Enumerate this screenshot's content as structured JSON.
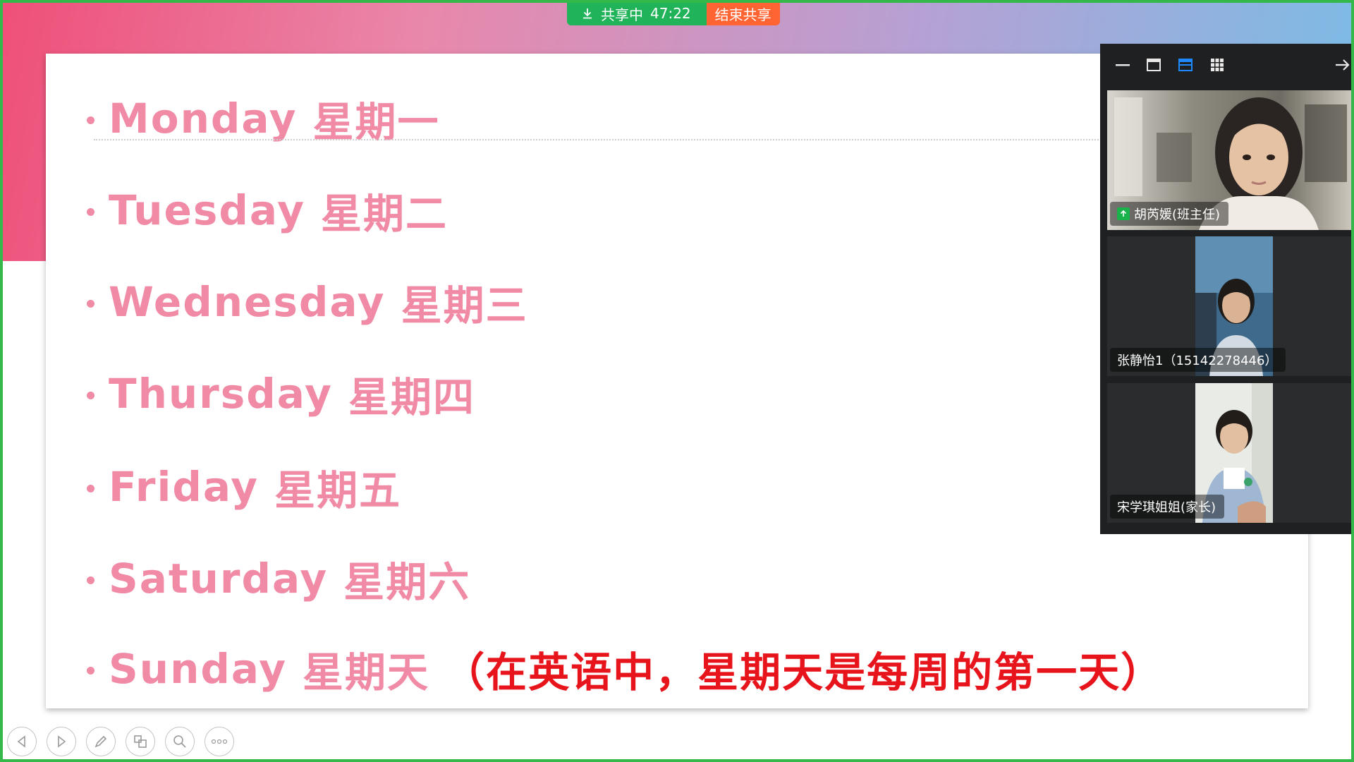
{
  "share_bar": {
    "status_label": "共享中",
    "timer": "47:22",
    "end_button": "结束共享"
  },
  "slide": {
    "days": [
      {
        "english": "Monday",
        "chinese": "星期一"
      },
      {
        "english": "Tuesday",
        "chinese": "星期二"
      },
      {
        "english": "Wednesday",
        "chinese": "星期三"
      },
      {
        "english": "Thursday",
        "chinese": "星期四"
      },
      {
        "english": "Friday",
        "chinese": "星期五"
      },
      {
        "english": "Saturday",
        "chinese": "星期六"
      },
      {
        "english": "Sunday",
        "chinese": "星期天"
      }
    ],
    "sunday_note": "（在英语中，星期天是每周的第一天）",
    "colors": {
      "day_text": "#f08aa5",
      "note_text": "#e8141c"
    }
  },
  "video_panel": {
    "toolbar_icons": [
      "minimize-icon",
      "window-icon",
      "speaker-view-icon",
      "grid-view-icon",
      "collapse-arrow-icon"
    ],
    "participants": [
      {
        "name": "胡芮媛(班主任)",
        "role_badge": "host-upload-icon"
      },
      {
        "name": "张静怡1（15142278446）"
      },
      {
        "name": "宋学琪姐姐(家长)"
      }
    ]
  },
  "bottom_toolbar": {
    "icons": [
      "previous-icon",
      "next-icon",
      "pen-icon",
      "pages-icon",
      "zoom-icon",
      "more-icon"
    ]
  },
  "colors": {
    "share_green": "#20b35a",
    "end_share_orange": "#ff6432",
    "frame_green": "#35b84a",
    "panel_bg": "#1f2021",
    "active_view_blue": "#1e88ff"
  }
}
